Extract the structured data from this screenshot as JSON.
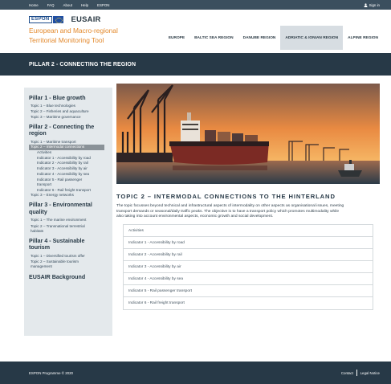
{
  "topnav": {
    "items": [
      "Home",
      "FAQ",
      "About",
      "Help",
      "ESPON"
    ],
    "sign_in": "Sign in"
  },
  "logo": {
    "espon": "ESPON",
    "eusair": "EUSAIR",
    "line1": "European and Macro-regional",
    "line2": "Territorial Monitoring Tool"
  },
  "regions": {
    "tabs": [
      "EUROPE",
      "BALTIC SEA REGION",
      "DANUBE REGION",
      "ADRIATIC & IONIAN REGION",
      "ALPINE REGION"
    ],
    "active": "ADRIATIC & IONIAN REGION"
  },
  "band": {
    "title": "PILLAR 2 - CONNECTING THE REGION"
  },
  "sidebar": {
    "pillar1": {
      "title": "Pillar 1 - Blue growth",
      "topics": [
        "Topic 1 – Blue technologies",
        "Topic 2 – Fisheries and aquaculture",
        "Topic 3 – Maritime governance"
      ]
    },
    "pillar2": {
      "title_line1": "Pillar 2 - Connecting the",
      "title_line2": "region",
      "topic1": "Topic 1 – Maritime transport",
      "topic2": "Topic 2 – Intermodal connections",
      "subitems": [
        "Activities",
        "Indicator 1 - Accessibility by road",
        "Indicator 2 - Accessibility by rail",
        "Indicator 3 - Accessibility by air",
        "Indicator 4 - Accessibility by sea"
      ],
      "indicator5_line1": "Indicator 5 - Rail passenger",
      "indicator5_line2": "transport",
      "indicator6": "Indicator 6 - Rail freight transport",
      "topic3": "Topic 3 – Energy networks"
    },
    "pillar3": {
      "title_line1": "Pillar 3 - Environmental",
      "title_line2": "quality",
      "topic1": "Topic 1 – The marine environment",
      "topic2_line1": "Topic 2 – Transnational terrestrial",
      "topic2_line2": "habitats"
    },
    "pillar4": {
      "title_line1": "Pillar 4 - Sustainable",
      "title_line2": "tourism",
      "topic1": "Topic 1 – Diversified tourism offer",
      "topic2_line1": "Topic 2 – Sustainable tourism",
      "topic2_line2": "management"
    },
    "background": "EUSAIR Background"
  },
  "content": {
    "heading": "TOPIC 2 – INTERMODAL CONNECTIONS TO THE HINTERLAND",
    "intro_line1": "The topic focusses beyond technical and infrastructural aspects of intermodality on other aspects as organisational issues, meeting",
    "intro_line2": "transport demands or seasonal/daily traffic peaks. The objective is to have a transport policy which promotes multimodality while",
    "intro_line3": "also taking into account environmental aspects, economic growth and social development.",
    "links": [
      "Activities",
      "Indicator 1 - Accessibility by road",
      "Indicator 2 - Accessibility by rail",
      "Indicator 3 - Accessibility by air",
      "Indicator 4 - Accessibility by sea",
      "Indicator 5 - Rail passenger transport",
      "Indicator 6 - Rail freight transport"
    ]
  },
  "footer": {
    "copyright": "ESPON Programme © 2020",
    "contact": "Contact",
    "legal": "Legal Notice"
  },
  "colors": {
    "nav_dark": "#273947",
    "accent_orange": "#e3892c",
    "sidebar_bg": "#e4e9ec",
    "active_tab": "#d7dde2",
    "selected_topic": "#8a9298"
  },
  "icons": {
    "sign_in": "user-icon",
    "logo_flag": "eu-flag-icon"
  }
}
